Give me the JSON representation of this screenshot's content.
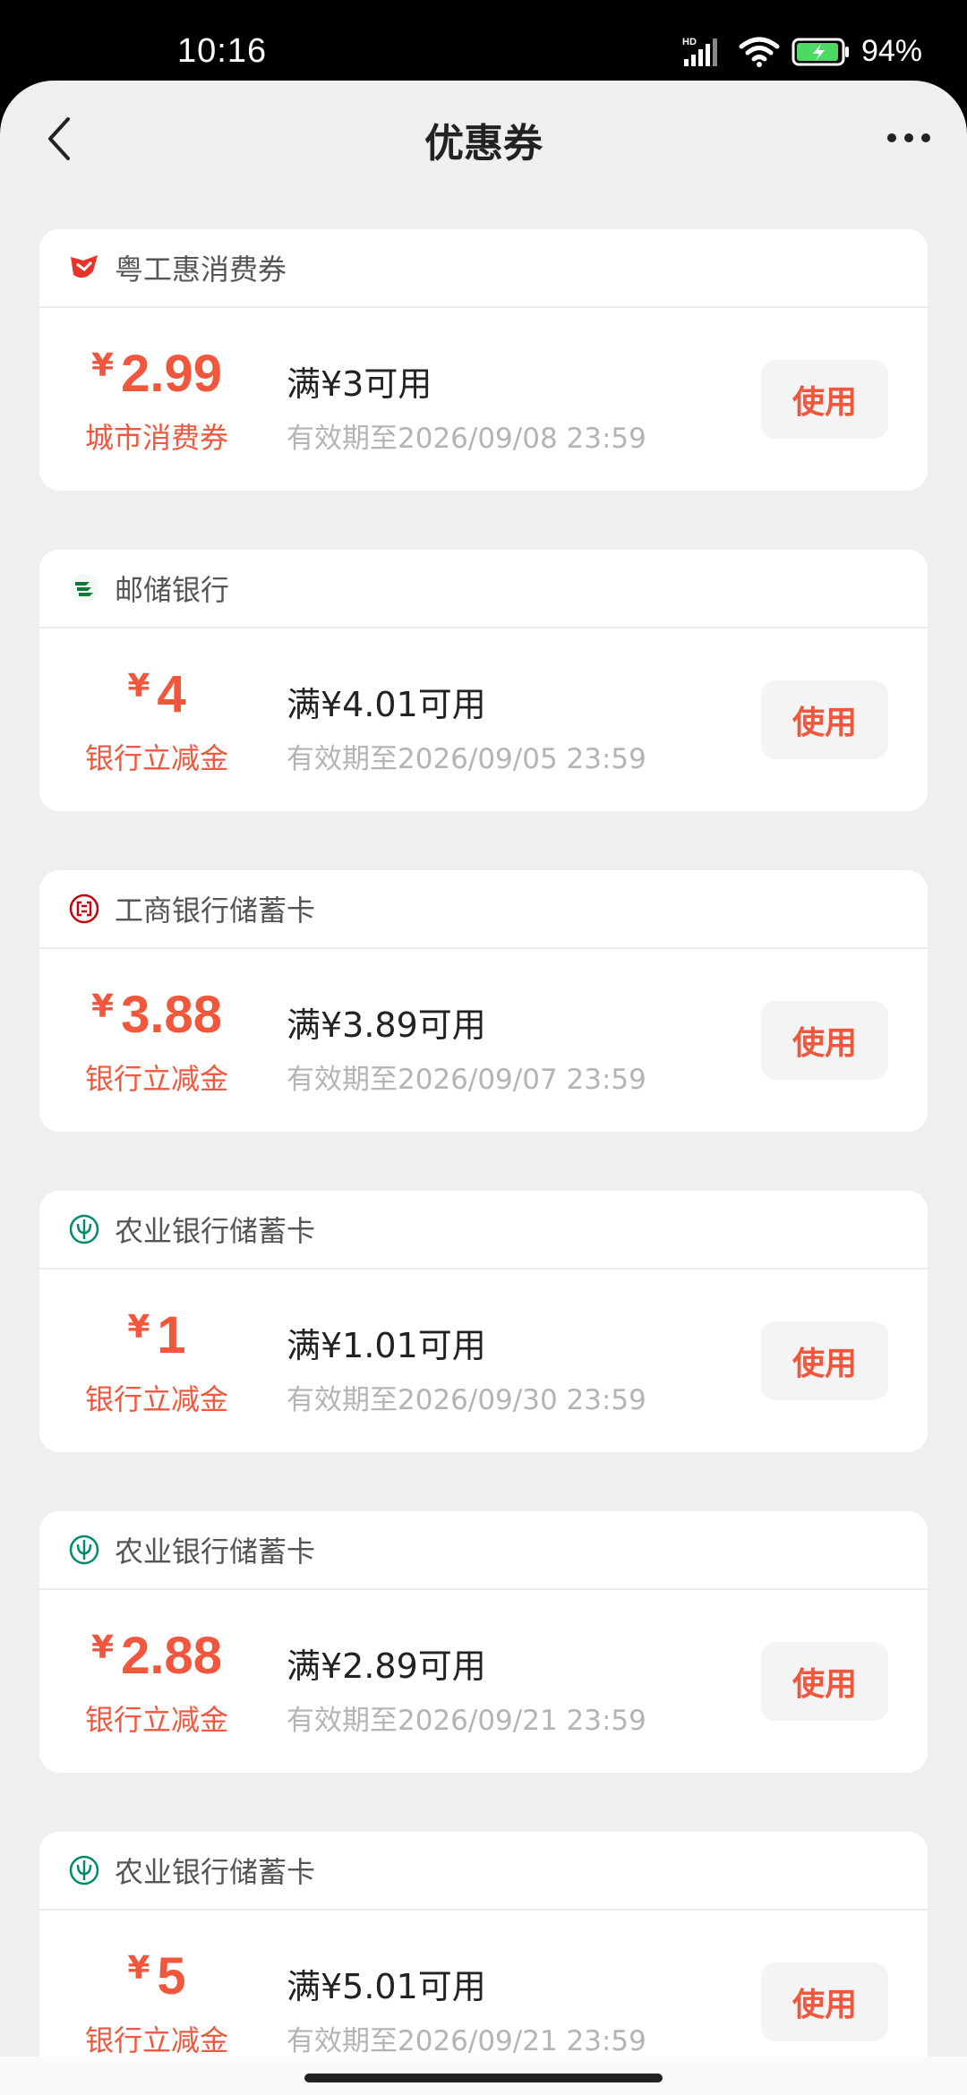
{
  "status_bar": {
    "time": "10:16",
    "battery": "94%"
  },
  "header": {
    "title": "优惠券"
  },
  "coupons": [
    {
      "bank": "粤工惠消费券",
      "icon": "yuegonghui-logo-icon",
      "currency": "¥",
      "amount": "2.99",
      "type": "城市消费券",
      "condition": "满¥3可用",
      "expiry": "有效期至2026/09/08 23:59",
      "button": "使用"
    },
    {
      "bank": "邮储银行",
      "icon": "psbc-logo-icon",
      "currency": "¥",
      "amount": "4",
      "type": "银行立减金",
      "condition": "满¥4.01可用",
      "expiry": "有效期至2026/09/05 23:59",
      "button": "使用"
    },
    {
      "bank": "工商银行储蓄卡",
      "icon": "icbc-logo-icon",
      "currency": "¥",
      "amount": "3.88",
      "type": "银行立减金",
      "condition": "满¥3.89可用",
      "expiry": "有效期至2026/09/07 23:59",
      "button": "使用"
    },
    {
      "bank": "农业银行储蓄卡",
      "icon": "abc-logo-icon",
      "currency": "¥",
      "amount": "1",
      "type": "银行立减金",
      "condition": "满¥1.01可用",
      "expiry": "有效期至2026/09/30 23:59",
      "button": "使用"
    },
    {
      "bank": "农业银行储蓄卡",
      "icon": "abc-logo-icon",
      "currency": "¥",
      "amount": "2.88",
      "type": "银行立减金",
      "condition": "满¥2.89可用",
      "expiry": "有效期至2026/09/21 23:59",
      "button": "使用"
    },
    {
      "bank": "农业银行储蓄卡",
      "icon": "abc-logo-icon",
      "currency": "¥",
      "amount": "5",
      "type": "银行立减金",
      "condition": "满¥5.01可用",
      "expiry": "有效期至2026/09/21 23:59",
      "button": "使用"
    }
  ],
  "colors": {
    "accent": "#f0573d",
    "background": "#efefef",
    "card": "#ffffff",
    "muted_text": "#b4b4b4"
  }
}
